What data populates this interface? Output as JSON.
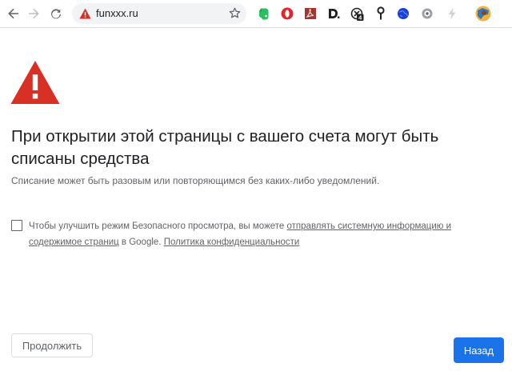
{
  "toolbar": {
    "url": "funxxx.ru",
    "icons": {
      "back": "arrow-left-icon",
      "forward": "arrow-right-icon",
      "reload": "reload-icon",
      "security": "warning-triangle-icon",
      "bookmark": "star-icon"
    },
    "extensions": [
      "evernote-icon",
      "opera-icon",
      "pdf-icon",
      "d-icon",
      "counter-icon",
      "pin-icon",
      "globe-icon",
      "circle-icon",
      "lightning-icon",
      "avatar"
    ],
    "ext_counter_text": "4"
  },
  "interstitial": {
    "heading": "При открытии этой страницы с вашего счета могут быть списаны средства",
    "subtext": "Списание может быть разовым или повторяющимся без каких-либо уведомлений.",
    "optin": {
      "text_before": "Чтобы улучшить режим Безопасного просмотра, вы можете ",
      "link_send": "отправлять системную информацию и содержимое страниц",
      "text_middle": " в Google. ",
      "link_privacy": "Политика конфиденциальности"
    },
    "buttons": {
      "continue": "Продолжить",
      "back": "Назад"
    }
  },
  "colors": {
    "warning_red": "#d93025",
    "primary_blue": "#1a73e8",
    "text_primary": "#202124",
    "text_secondary": "#5f6368"
  }
}
